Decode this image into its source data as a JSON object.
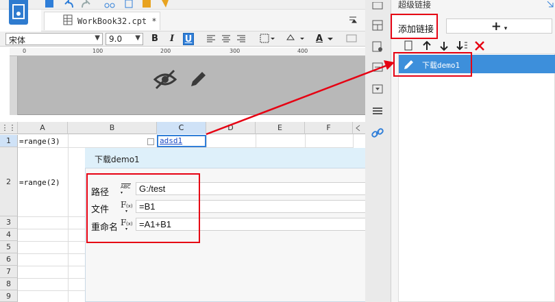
{
  "tab": {
    "title": "WorkBook32.cpt *"
  },
  "toolbar": {
    "font_name": "宋体",
    "font_size": "9.0",
    "bold": "B",
    "italic": "I",
    "underline": "U",
    "font_color_glyph": "A"
  },
  "ruler": {
    "marks": [
      "0",
      "100",
      "200",
      "300",
      "400"
    ]
  },
  "sheet": {
    "columns": [
      "A",
      "B",
      "C",
      "D",
      "E",
      "F"
    ],
    "rows": [
      "1",
      "2",
      "3",
      "4",
      "5",
      "6",
      "7",
      "8",
      "9"
    ],
    "cells": {
      "a1": "=range(3)",
      "a2": "=range(2)",
      "c1": "adsd1"
    }
  },
  "popup": {
    "title": "下载demo1",
    "fields": [
      {
        "label": "路径",
        "value": "G:/test",
        "icon": "text-abc-icon"
      },
      {
        "label": "文件",
        "value": "=B1",
        "icon": "formula-icon"
      },
      {
        "label": "重命名",
        "value": "=A1+B1",
        "icon": "formula-icon"
      }
    ]
  },
  "panel": {
    "header": "超级链接",
    "add_link": "添加链接",
    "add_plus": "+",
    "items": [
      "下载demo1"
    ]
  },
  "colors": {
    "accent": "#2f7ed8",
    "annotation": "#e60012",
    "selected_item": "#3d8fdb"
  }
}
